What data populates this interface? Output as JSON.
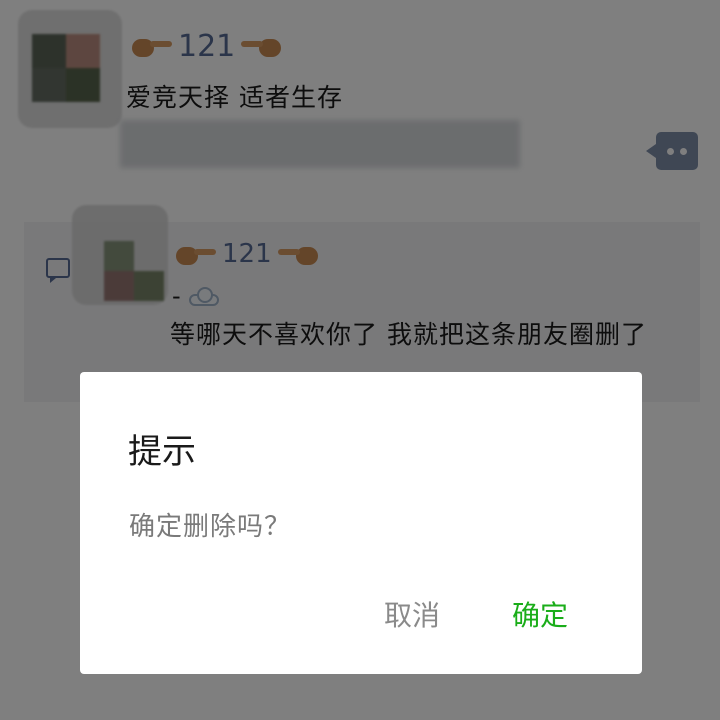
{
  "post": {
    "author_name": "121",
    "text": "爱竞天择 适者生存"
  },
  "comment": {
    "author_name": "121",
    "prefix": "-",
    "text": "等哪天不喜欢你了 我就把这条朋友圈删了"
  },
  "icons": {
    "pointing_hand_right": "backhand-index-pointing-right",
    "pointing_hand_left": "backhand-index-pointing-left",
    "cloud": "cloud",
    "more": "more-dots",
    "comment": "comment-bubble"
  },
  "dialog": {
    "title": "提示",
    "message": "确定删除吗？",
    "cancel_label": "取消",
    "confirm_label": "确定"
  },
  "colors": {
    "link_blue": "#576b95",
    "confirm_green": "#1aad19",
    "overlay": "rgba(0,0,0,0.5)"
  }
}
